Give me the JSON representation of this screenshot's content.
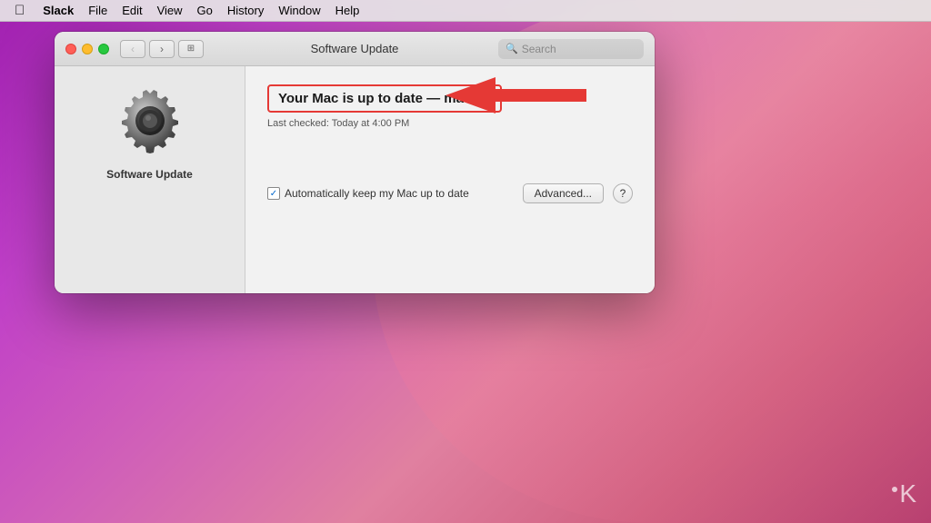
{
  "desktop": {
    "background": "purple-pink gradient"
  },
  "menubar": {
    "apple_label": "",
    "app_name": "Slack",
    "items": [
      "File",
      "Edit",
      "View",
      "Go",
      "History",
      "Window",
      "Help"
    ]
  },
  "window": {
    "title": "Software Update",
    "search_placeholder": "Search",
    "nav": {
      "back_label": "‹",
      "forward_label": "›",
      "grid_label": "⊞"
    }
  },
  "sidebar": {
    "icon_alt": "Software Update gear icon",
    "label": "Software Update"
  },
  "main": {
    "update_title": "Your Mac is up to date — macOS",
    "last_checked": "Last checked: Today at 4:00 PM",
    "checkbox_label": "Automatically keep my Mac up to date",
    "checkbox_checked": true,
    "advanced_button": "Advanced...",
    "help_button": "?"
  },
  "watermark": {
    "letter": "K"
  }
}
